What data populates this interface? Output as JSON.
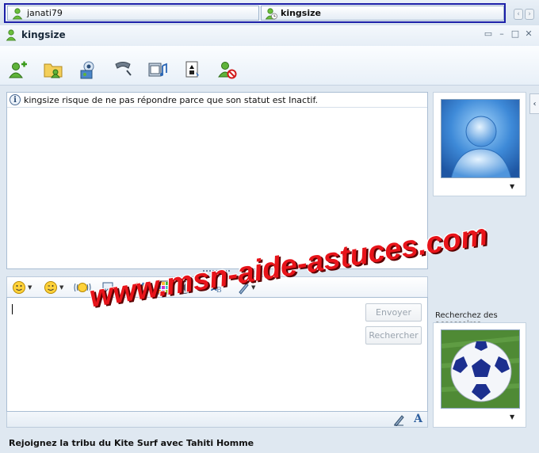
{
  "tabs": [
    {
      "label": "janati79",
      "icon": "contact-online-icon"
    },
    {
      "label": "kingsize",
      "icon": "contact-away-icon"
    }
  ],
  "window": {
    "title": "kingsize",
    "controls": [
      "menu-icon",
      "minimize-icon",
      "maximize-icon",
      "close-icon"
    ]
  },
  "toolbar": {
    "buttons": [
      "invite-contact-icon",
      "send-files-icon",
      "webcam-icon",
      "call-icon",
      "activities-icon",
      "games-icon",
      "block-contact-icon"
    ]
  },
  "conversation": {
    "notice": "kingsize risque de ne pas répondre parce que son statut est Inactif."
  },
  "format_toolbar": {
    "buttons": [
      "emoticon-icon",
      "wink-icon",
      "nudge-icon",
      "voice-clip-icon",
      "background-icon",
      "color-grid-icon",
      "sound-icon",
      "text-style-icon",
      "handwriting-icon"
    ]
  },
  "input": {
    "value": "",
    "send_label": "Envoyer",
    "search_label": "Rechercher"
  },
  "status": {
    "promo": "Rejoignez la tribu du Kite Surf avec Tahiti Homme"
  },
  "sidebar": {
    "accessories_label": "Recherchez des accessoires"
  },
  "watermark": "www.msn-aide-astuces.com",
  "colors": {
    "tab_highlight_border": "#1b1fa8",
    "watermark": "#e8141a"
  }
}
